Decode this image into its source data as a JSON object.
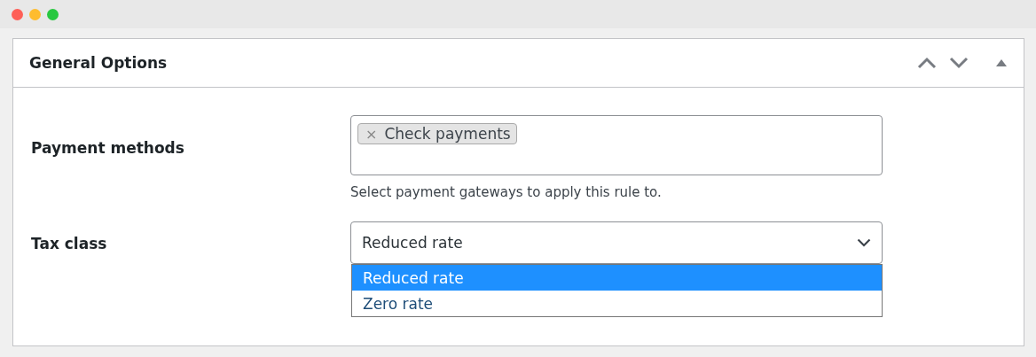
{
  "panel": {
    "title": "General Options"
  },
  "payment_methods": {
    "label": "Payment methods",
    "tags": [
      {
        "remove": "×",
        "text": "Check payments"
      }
    ],
    "hint": "Select payment gateways to apply this rule to."
  },
  "tax_class": {
    "label": "Tax class",
    "value": "Reduced rate",
    "expanded": true,
    "options": [
      {
        "label": "Reduced rate",
        "selected": true
      },
      {
        "label": "Zero rate",
        "selected": false
      }
    ]
  }
}
